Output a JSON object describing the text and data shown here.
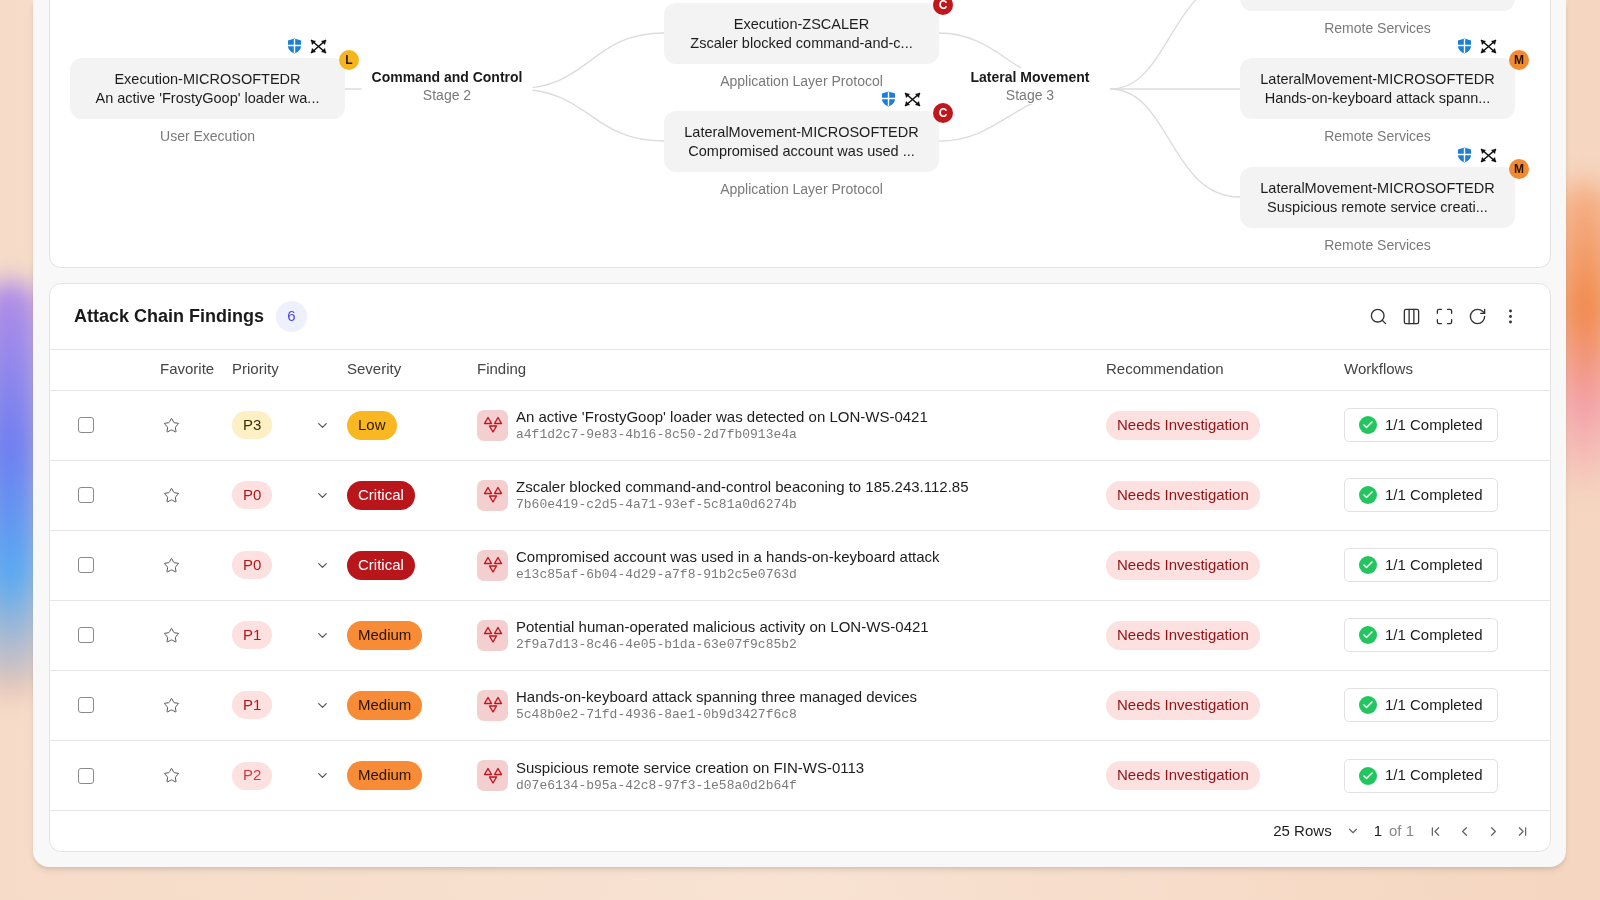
{
  "graph": {
    "nodes": [
      {
        "title": "Execution-MICROSOFTEDR",
        "summary": "An active 'FrostyGoop' loader wa...",
        "technique": "User Execution",
        "badge": {
          "text": "L",
          "kind": "low"
        }
      },
      {
        "title": "Execution-ZSCALER",
        "summary": "Zscaler blocked command-and-c...",
        "technique": "Application Layer Protocol",
        "badge": {
          "text": "C",
          "kind": "critical"
        }
      },
      {
        "title": "LateralMovement-MICROSOFTEDR",
        "summary": "Compromised account was used ...",
        "technique": "Application Layer Protocol",
        "badge": {
          "text": "C",
          "kind": "critical"
        }
      },
      {
        "technique": "Remote Services"
      },
      {
        "title": "LateralMovement-MICROSOFTEDR",
        "summary": "Hands-on-keyboard attack spann...",
        "technique": "Remote Services",
        "badge": {
          "text": "M",
          "kind": "medium"
        }
      },
      {
        "title": "LateralMovement-MICROSOFTEDR",
        "summary": "Suspicious remote service creati...",
        "technique": "Remote Services",
        "badge": {
          "text": "M",
          "kind": "medium"
        }
      }
    ],
    "stages": [
      {
        "title": "Command and Control",
        "subtitle": "Stage 2"
      },
      {
        "title": "Lateral Movement",
        "subtitle": "Stage 3"
      }
    ]
  },
  "findings": {
    "title": "Attack Chain Findings",
    "count": "6",
    "columns": [
      "Favorite",
      "Priority",
      "Severity",
      "Finding",
      "Recommendation",
      "Workflows"
    ],
    "rows": [
      {
        "checked": false,
        "favorite": false,
        "priority": {
          "label": "P3",
          "kind": "p3"
        },
        "severity": {
          "label": "Low",
          "kind": "low"
        },
        "finding": "An active 'FrostyGoop' loader was detected on LON-WS-0421",
        "id": "a4f1d2c7-9e83-4b16-8c50-2d7fb0913e4a",
        "recommendation": "Needs Investigation",
        "workflow": "1/1 Completed"
      },
      {
        "checked": false,
        "favorite": false,
        "priority": {
          "label": "P0",
          "kind": "p0"
        },
        "severity": {
          "label": "Critical",
          "kind": "critical"
        },
        "finding": "Zscaler blocked command-and-control beaconing to 185.243.112.85",
        "id": "7b60e419-c2d5-4a71-93ef-5c81a0d6274b",
        "recommendation": "Needs Investigation",
        "workflow": "1/1 Completed"
      },
      {
        "checked": false,
        "favorite": false,
        "priority": {
          "label": "P0",
          "kind": "p0"
        },
        "severity": {
          "label": "Critical",
          "kind": "critical"
        },
        "finding": "Compromised account was used in a hands-on-keyboard attack",
        "id": "e13c85af-6b04-4d29-a7f8-91b2c5e0763d",
        "recommendation": "Needs Investigation",
        "workflow": "1/1 Completed"
      },
      {
        "checked": false,
        "favorite": false,
        "priority": {
          "label": "P1",
          "kind": "p1"
        },
        "severity": {
          "label": "Medium",
          "kind": "medium"
        },
        "finding": "Potential human-operated malicious activity on LON-WS-0421",
        "id": "2f9a7d13-8c46-4e05-b1da-63e07f9c85b2",
        "recommendation": "Needs Investigation",
        "workflow": "1/1 Completed"
      },
      {
        "checked": false,
        "favorite": false,
        "priority": {
          "label": "P1",
          "kind": "p1"
        },
        "severity": {
          "label": "Medium",
          "kind": "medium"
        },
        "finding": "Hands-on-keyboard attack spanning three managed devices",
        "id": "5c48b0e2-71fd-4936-8ae1-0b9d3427f6c8",
        "recommendation": "Needs Investigation",
        "workflow": "1/1 Completed"
      },
      {
        "checked": false,
        "favorite": false,
        "priority": {
          "label": "P2",
          "kind": "p2"
        },
        "severity": {
          "label": "Medium",
          "kind": "medium"
        },
        "finding": "Suspicious remote service creation on FIN-WS-0113",
        "id": "d07e6134-b95a-42c8-97f3-1e58a0d2b64f",
        "recommendation": "Needs Investigation",
        "workflow": "1/1 Completed"
      }
    ],
    "pagination": {
      "rows_per_page": "25 Rows",
      "page": "1",
      "page_total": "of 1"
    }
  }
}
